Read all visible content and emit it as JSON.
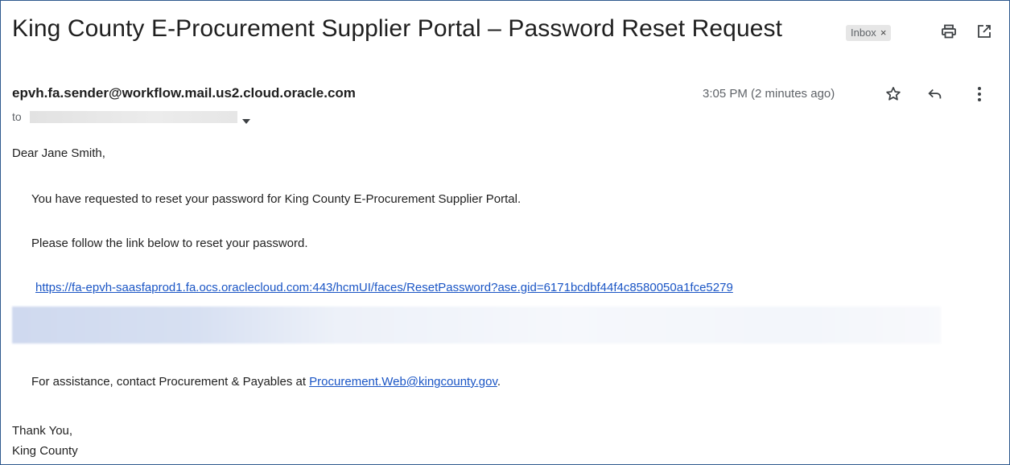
{
  "email": {
    "subject": "King County E-Procurement Supplier Portal – Password Reset Request",
    "label": "Inbox",
    "label_remove": "×",
    "sender": "epvh.fa.sender@workflow.mail.us2.cloud.oracle.com",
    "to_label": "to",
    "time": "3:05 PM (2 minutes ago)",
    "icons": {
      "print": "print-icon",
      "open_new_window": "open-in-new-window-icon",
      "star": "star-icon",
      "reply": "reply-icon",
      "more": "more-vertical-icon",
      "recipient_dropdown": "chevron-down-icon"
    }
  },
  "message": {
    "greeting": "Dear Jane Smith,",
    "line1": "You have requested to reset your password for King County E-Procurement Supplier Portal.",
    "line2": "Please follow the link below to reset your password.",
    "reset_link": "https://fa-epvh-saasfaprod1.fa.ocs.oraclecloud.com:443/hcmUI/faces/ResetPassword?ase.gid=6171bcdbf44f4c8580050a1fce5279",
    "assist_prefix": "For assistance, contact Procurement & Payables at ",
    "assist_email": "Procurement.Web@kingcounty.gov",
    "assist_suffix": ".",
    "signoff": "Thank You,",
    "signature": "King County"
  },
  "colors": {
    "link": "#1a55c5",
    "border": "#2f5a8e",
    "muted_text": "#5f6368"
  }
}
